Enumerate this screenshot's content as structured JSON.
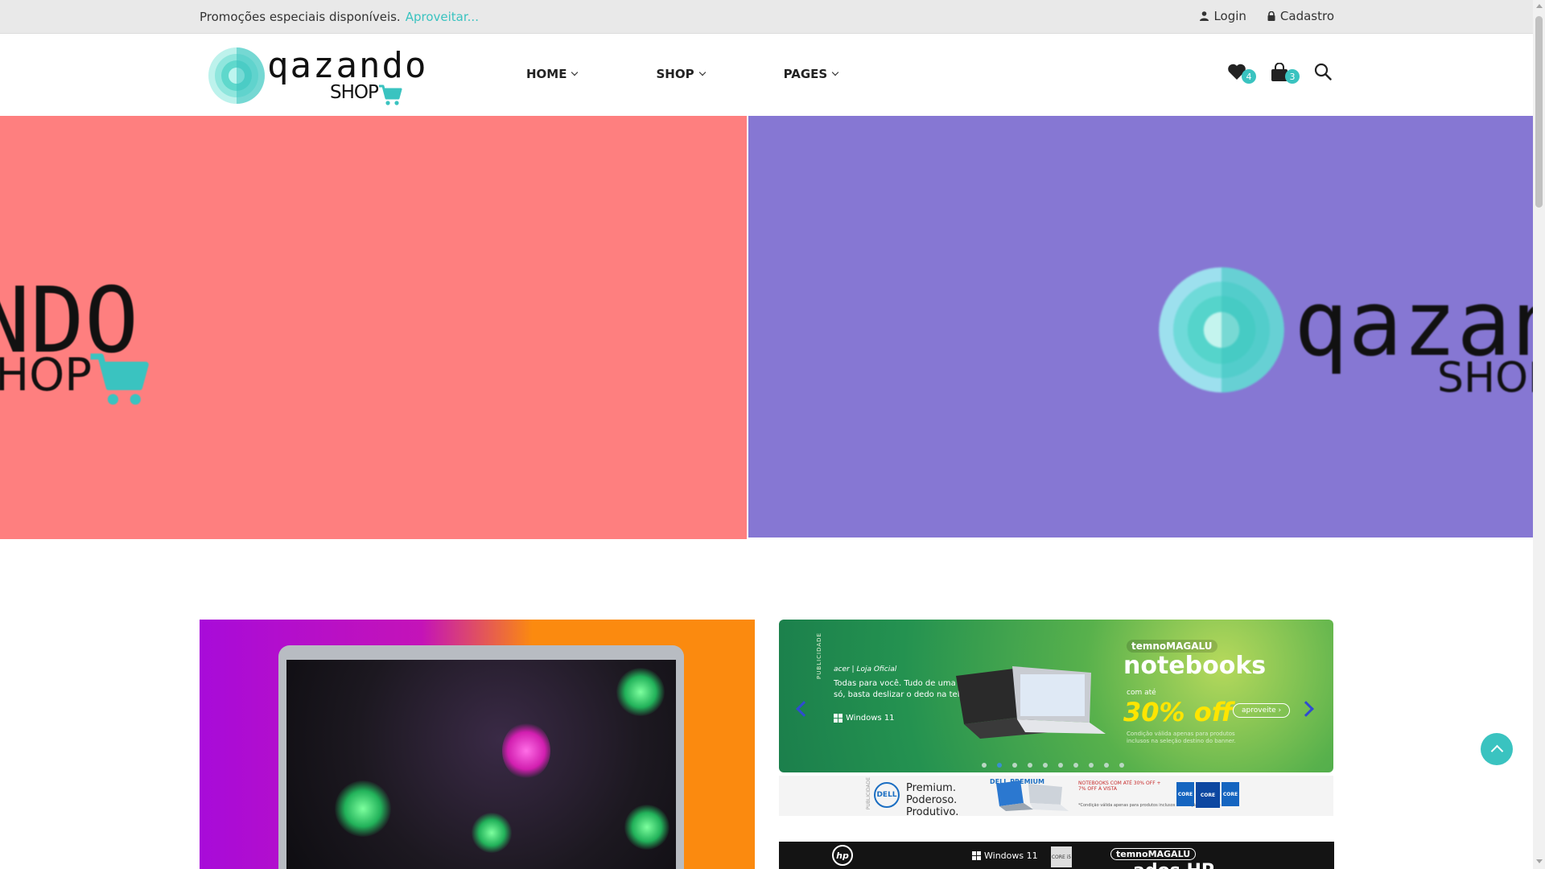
{
  "topbar": {
    "promo_text": "Promoções especiais disponíveis.",
    "promo_cta": "Aproveitar...",
    "login": "Login",
    "register": "Cadastro"
  },
  "brand": {
    "name": "qazando",
    "subtitle": "SHOP",
    "accent_color": "#3ac3c0"
  },
  "nav": [
    {
      "label": "HOME"
    },
    {
      "label": "SHOP"
    },
    {
      "label": "PAGES"
    }
  ],
  "header_icons": {
    "wishlist_count": "4",
    "cart_count": "3"
  },
  "hero": {
    "left_big": "NDO",
    "left_shop": "HOP",
    "right_word": "qazand",
    "right_shop": "SHOP",
    "left_color": "#fe7f7f",
    "right_color": "#8677d3"
  },
  "banner_notebooks": {
    "side_label": "PUBLICIDADE",
    "brand_label": "acer | Loja Oficial",
    "copy": "Todas para você. Tudo de uma vez só, basta deslizar o dedo na tela.",
    "os": "Windows 11",
    "store": "temnoMAGALU",
    "headline": "notebooks",
    "with_up_to": "com até",
    "discount": "30% off",
    "cta": "aproveite ›",
    "fine_print": "Condição válida apenas para produtos inclusos na seleção destino do banner.",
    "active_dot": 1,
    "dots_total": 10
  },
  "banner_dell": {
    "side_label": "PUBLICIDADE",
    "brand": "DELL",
    "tagline": "Premium. Poderoso. Produtivo.",
    "product_line": "DELL PREMIUM",
    "offer": "NOTEBOOKS COM ATÉ 30% OFF + 7% OFF À VISTA",
    "fine_print": "*Condição válida apenas para produtos inclusos na seleção destino do banner.",
    "chip_label": "CORE"
  },
  "banner_hp": {
    "brand": "hp",
    "os": "Windows 11",
    "chip": "CORE i5",
    "store": "temnoMAGALU",
    "partial_headline": "ados HP"
  }
}
